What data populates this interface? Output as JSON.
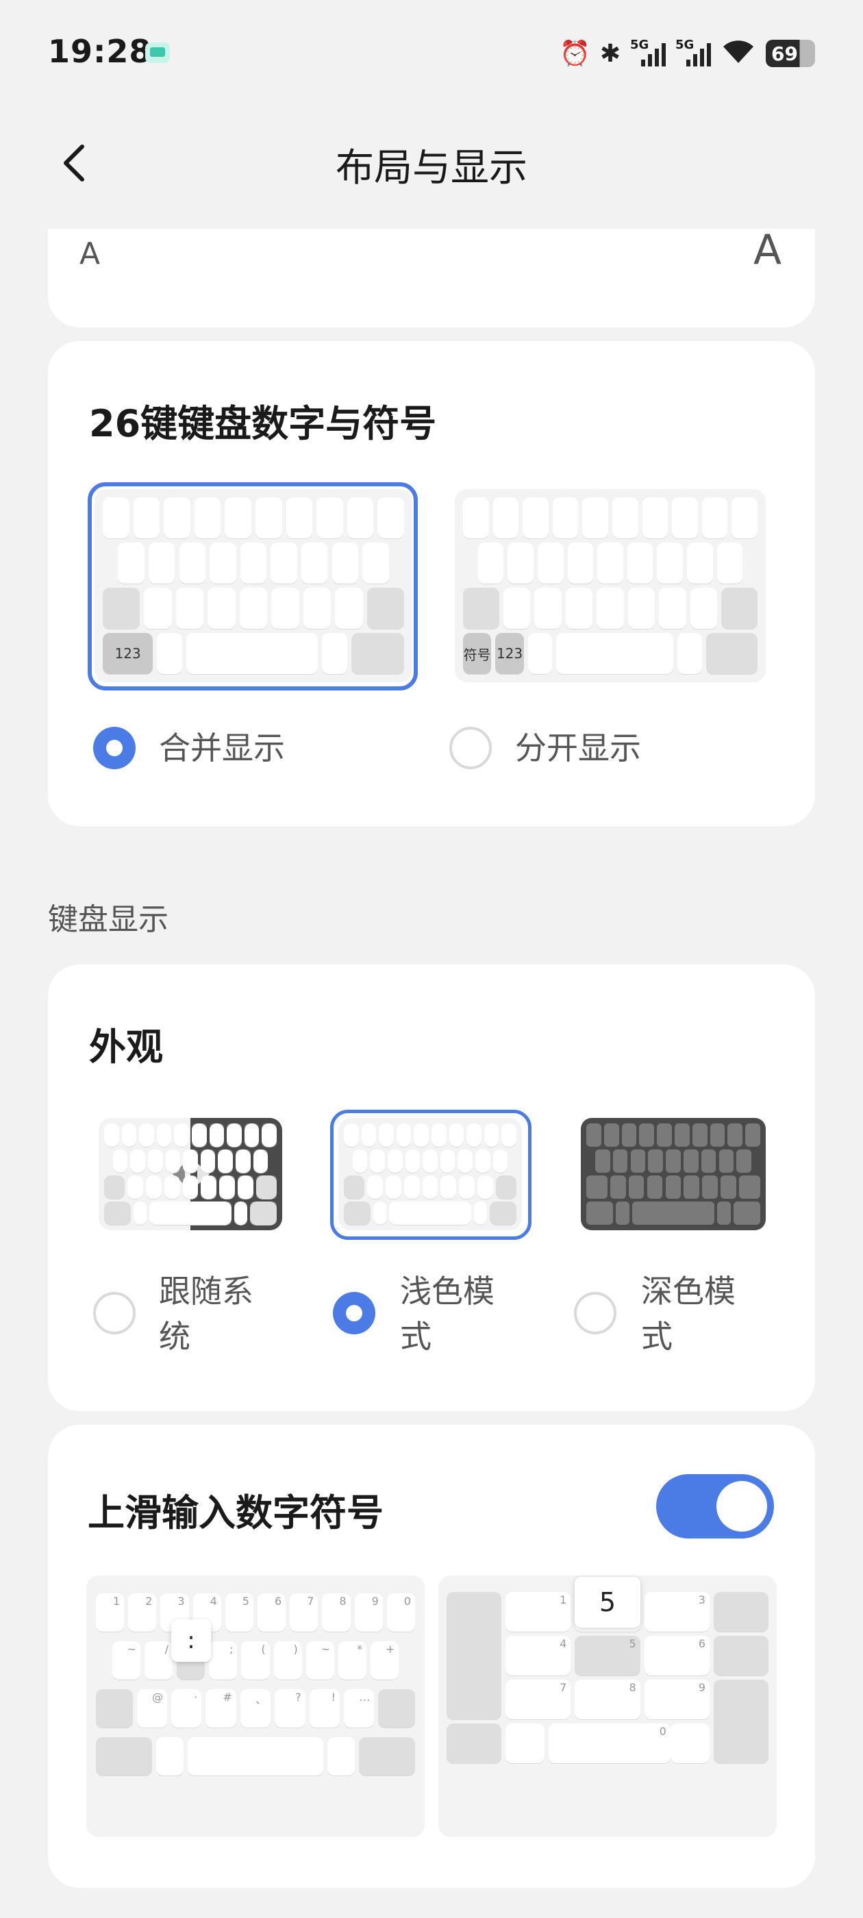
{
  "status": {
    "time": "19:28",
    "signal1": "5G",
    "signal2": "5G",
    "battery": "69"
  },
  "header": {
    "title": "布局与显示",
    "back_icon": "chevron-left-icon"
  },
  "font_size": {
    "small": "A",
    "large": "A"
  },
  "number_symbol": {
    "title": "26键键盘数字与符号",
    "options": [
      {
        "label": "合并显示",
        "selected": true,
        "key_labels": [
          "123"
        ]
      },
      {
        "label": "分开显示",
        "selected": false,
        "key_labels": [
          "符号",
          "123"
        ]
      }
    ]
  },
  "keyboard_display": {
    "section_label": "键盘显示",
    "appearance": {
      "title": "外观",
      "options": [
        {
          "label": "跟随系\n统",
          "selected": false
        },
        {
          "label": "浅色模\n式",
          "selected": true
        },
        {
          "label": "深色模\n式",
          "selected": false
        }
      ]
    }
  },
  "swipe_up": {
    "title": "上滑输入数字符号",
    "enabled": true,
    "preview_left_popup": ":",
    "preview_right_popup": "5",
    "left_digits": [
      "1",
      "2",
      "3",
      "4",
      "5",
      "6",
      "7",
      "8",
      "9",
      "0"
    ],
    "left_symbols_row2": [
      "~",
      "/",
      ":",
      ";",
      "(",
      ")",
      "~",
      "*",
      "+"
    ],
    "left_symbols_row3": [
      "@",
      "·",
      "#",
      "、",
      "?",
      "!",
      "…"
    ],
    "right_digits": [
      "1",
      "3",
      "4",
      "5",
      "6",
      "7",
      "8",
      "9",
      "0"
    ]
  },
  "colors": {
    "accent": "#4b7be5",
    "background": "#f2f2f2",
    "card": "#ffffff"
  }
}
